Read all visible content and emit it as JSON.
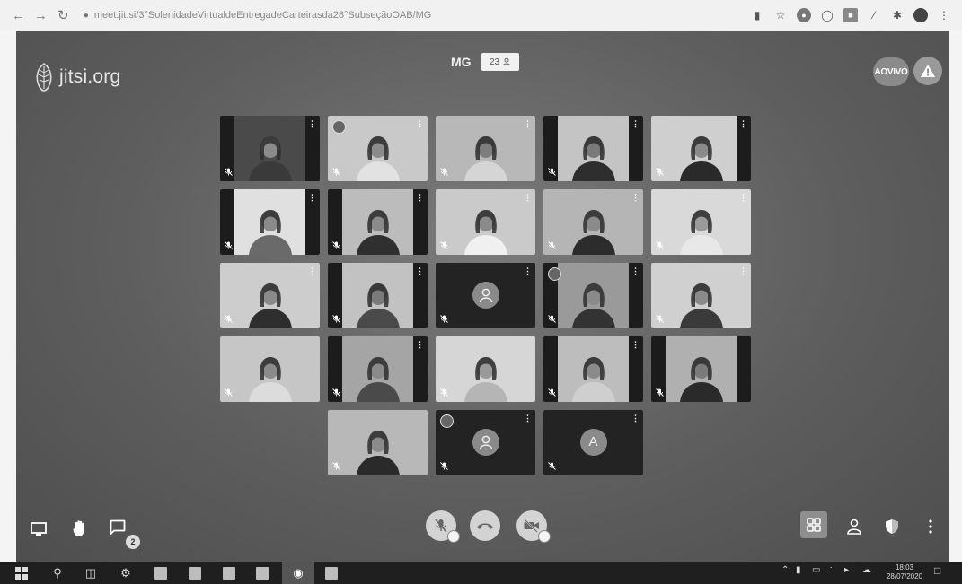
{
  "browser": {
    "url": "meet.jit.si/3°SolenidadeVirtualdeEntregadeCarteirasda28°SubseçãoOAB/MG",
    "nav_back_icon": "back-arrow-icon",
    "nav_forward_icon": "forward-arrow-icon",
    "reload_icon": "reload-icon"
  },
  "meeting": {
    "logo_text": "jitsi.org",
    "room_name": "MG",
    "participant_count": "23",
    "live_label": "AOVIVO"
  },
  "tiles": [
    {
      "type": "video",
      "bg": "#4a4a4a",
      "skin": "#8a8a8a",
      "shirt": "#3a3a3a",
      "pillar": "both",
      "menu": true
    },
    {
      "type": "video",
      "bg": "#c9c9c9",
      "skin": "#8c8c8c",
      "shirt": "#e2e2e2",
      "pillar": "none",
      "menu": true,
      "badge": true
    },
    {
      "type": "video",
      "bg": "#b8b8b8",
      "skin": "#7d7d7d",
      "shirt": "#d5d5d5",
      "pillar": "none",
      "menu": true
    },
    {
      "type": "video",
      "bg": "#c4c4c4",
      "skin": "#7a7a7a",
      "shirt": "#2e2e2e",
      "pillar": "both",
      "menu": true
    },
    {
      "type": "video",
      "bg": "#cfcfcf",
      "skin": "#8a8a8a",
      "shirt": "#2a2a2a",
      "pillar": "right",
      "menu": true
    },
    {
      "type": "video",
      "bg": "#e0e0e0",
      "skin": "#8a8a8a",
      "shirt": "#6a6a6a",
      "pillar": "both",
      "menu": true
    },
    {
      "type": "video",
      "bg": "#bcbcbc",
      "skin": "#8a8a8a",
      "shirt": "#2f2f2f",
      "pillar": "both",
      "menu": true
    },
    {
      "type": "video",
      "bg": "#cacaca",
      "skin": "#8a8a8a",
      "shirt": "#f0f0f0",
      "pillar": "none",
      "menu": true
    },
    {
      "type": "video",
      "bg": "#b5b5b5",
      "skin": "#8a8a8a",
      "shirt": "#2c2c2c",
      "pillar": "none",
      "menu": true
    },
    {
      "type": "video",
      "bg": "#d9d9d9",
      "skin": "#9a9a9a",
      "shirt": "#e8e8e8",
      "pillar": "none",
      "menu": true
    },
    {
      "type": "video",
      "bg": "#cdcdcd",
      "skin": "#8a8a8a",
      "shirt": "#2e2e2e",
      "pillar": "none",
      "menu": true
    },
    {
      "type": "video",
      "bg": "#c2c2c2",
      "skin": "#7a7a7a",
      "shirt": "#4a4a4a",
      "pillar": "both",
      "menu": true
    },
    {
      "type": "avatar",
      "menu": true
    },
    {
      "type": "video",
      "bg": "#9a9a9a",
      "skin": "#8a8a8a",
      "shirt": "#333333",
      "pillar": "both",
      "menu": true,
      "badge": true
    },
    {
      "type": "video",
      "bg": "#d0d0d0",
      "skin": "#8a8a8a",
      "shirt": "#3a3a3a",
      "pillar": "none",
      "menu": true
    },
    {
      "type": "video",
      "bg": "#c6c6c6",
      "skin": "#8a8a8a",
      "shirt": "#dcdcdc",
      "pillar": "none",
      "menu": false
    },
    {
      "type": "video",
      "bg": "#a5a5a5",
      "skin": "#8a8a8a",
      "shirt": "#4a4a4a",
      "pillar": "both",
      "menu": true
    },
    {
      "type": "video",
      "bg": "#d6d6d6",
      "skin": "#9a9a9a",
      "shirt": "#b5b5b5",
      "pillar": "none",
      "menu": false
    },
    {
      "type": "video",
      "bg": "#bdbdbd",
      "skin": "#8a8a8a",
      "shirt": "#cfcfcf",
      "pillar": "both",
      "menu": true
    },
    {
      "type": "video",
      "bg": "#b0b0b0",
      "skin": "#7a7a7a",
      "shirt": "#2a2a2a",
      "pillar": "both",
      "menu": false
    },
    {
      "type": "video",
      "bg": "#b8b8b8",
      "skin": "#8a8a8a",
      "shirt": "#2a2a2a",
      "pillar": "none",
      "menu": false
    },
    {
      "type": "avatar",
      "menu": true,
      "badge": true
    },
    {
      "type": "letter",
      "letter": "A",
      "menu": true
    }
  ],
  "toolbar": {
    "chat_unread": "2"
  },
  "taskbar": {
    "time": "18:03",
    "date": "28/07/2020"
  }
}
